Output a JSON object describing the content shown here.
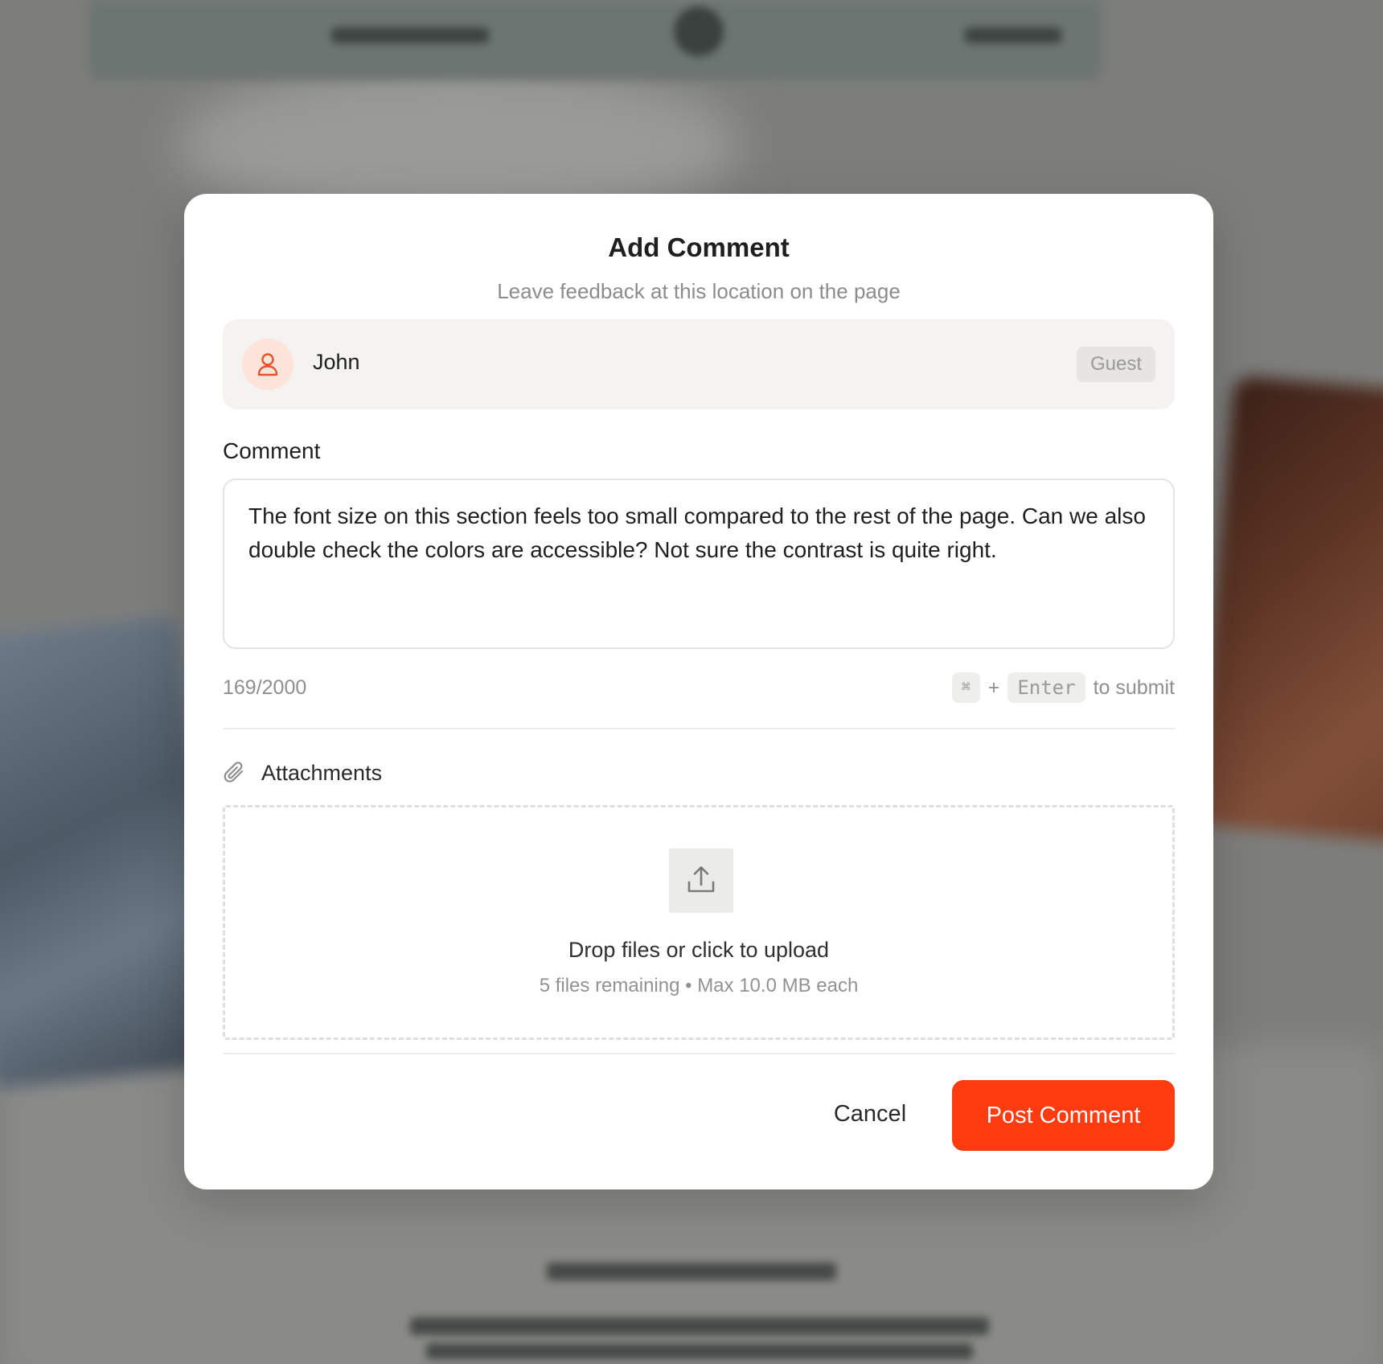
{
  "dialog": {
    "title": "Add Comment",
    "subtitle": "Leave feedback at this location on the page"
  },
  "user": {
    "name": "John",
    "badge": "Guest",
    "icon": "user-icon"
  },
  "comment": {
    "label": "Comment",
    "value": "The font size on this section feels too small compared to the rest of the page. Can we also double check the colors are accessible? Not sure the contrast is quite right.",
    "char_count": "169/2000"
  },
  "shortcut": {
    "modifier_key": "⌘",
    "plus": "+",
    "enter_key": "Enter",
    "suffix": "to submit"
  },
  "attachments": {
    "label": "Attachments",
    "icon": "paperclip-icon",
    "upload_icon": "upload-icon",
    "drop_title": "Drop files or click to upload",
    "drop_subtitle": "5 files remaining • Max 10.0 MB each"
  },
  "actions": {
    "cancel": "Cancel",
    "post": "Post Comment"
  },
  "colors": {
    "accent": "#ff3b0f",
    "avatar_bg": "#fde3da",
    "overlay": "#7d7e7c"
  }
}
